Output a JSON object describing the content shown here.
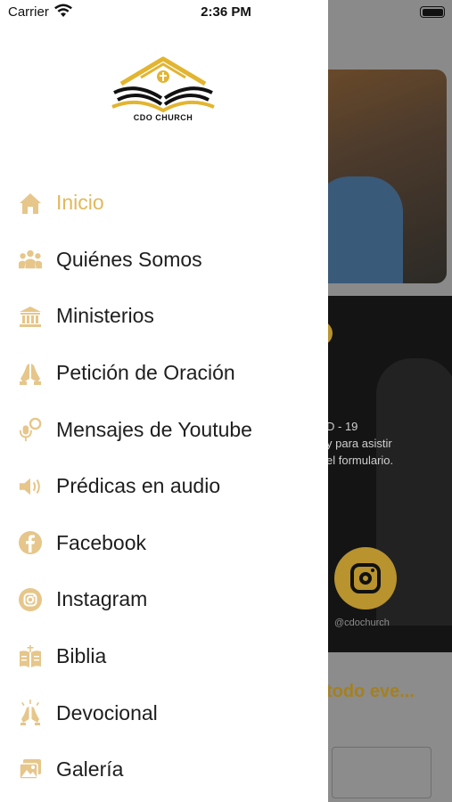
{
  "status_bar": {
    "carrier": "Carrier",
    "time": "2:36 PM"
  },
  "logo": {
    "text": "CDO CHURCH"
  },
  "colors": {
    "accent": "#e2b85c",
    "icon": "#e6c68a",
    "text": "#1e1e1e"
  },
  "menu": {
    "items": [
      {
        "label": "Inicio",
        "icon": "home-icon",
        "active": true
      },
      {
        "label": "Quiénes Somos",
        "icon": "people-icon",
        "active": false
      },
      {
        "label": "Ministerios",
        "icon": "temple-icon",
        "active": false
      },
      {
        "label": "Petición de Oración",
        "icon": "praying-hands-icon",
        "active": false
      },
      {
        "label": "Mensajes de Youtube",
        "icon": "microphone-icon",
        "active": false
      },
      {
        "label": "Prédicas en audio",
        "icon": "speaker-icon",
        "active": false
      },
      {
        "label": "Facebook",
        "icon": "facebook-icon",
        "active": false
      },
      {
        "label": "Instagram",
        "icon": "instagram-icon",
        "active": false
      },
      {
        "label": "Biblia",
        "icon": "bible-icon",
        "active": false
      },
      {
        "label": "Devocional",
        "icon": "devotional-icon",
        "active": false
      },
      {
        "label": "Galería",
        "icon": "gallery-icon",
        "active": false
      }
    ]
  },
  "background": {
    "covid_text": "D - 19",
    "line1": "y para asistir",
    "line2": "el formulario.",
    "handle": "@cdochurch",
    "headline": "todo eve..."
  }
}
